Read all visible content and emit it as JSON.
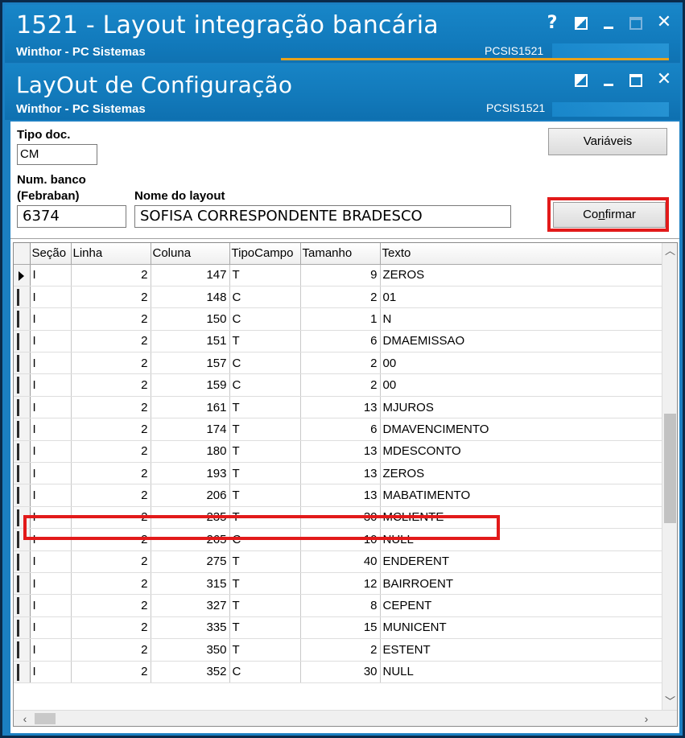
{
  "main_window": {
    "title": "1521 - Layout integração bancária",
    "subtitle": "Winthor - PC Sistemas",
    "code": "PCSIS1521"
  },
  "child_window": {
    "title": "LayOut de Configuração",
    "subtitle": "Winthor - PC Sistemas",
    "code": "PCSIS1521"
  },
  "form": {
    "tipo_doc_label": "Tipo doc.",
    "tipo_doc_value": "CM",
    "num_banco_label_line1": "Num. banco",
    "num_banco_label_line2": "(Febraban)",
    "num_banco_value": "6374",
    "nome_layout_label": "Nome do layout",
    "nome_layout_value": "SOFISA CORRESPONDENTE BRADESCO",
    "variaveis_label": "Variáveis",
    "confirmar_prefix": "Co",
    "confirmar_underlined": "n",
    "confirmar_suffix": "firmar"
  },
  "grid": {
    "columns": [
      "Seção",
      "Linha",
      "Coluna",
      "TipoCampo",
      "Tamanho",
      "Texto"
    ],
    "rows": [
      [
        "I",
        "2",
        "147",
        "T",
        "9",
        "ZEROS"
      ],
      [
        "I",
        "2",
        "148",
        "C",
        "2",
        "01"
      ],
      [
        "I",
        "2",
        "150",
        "C",
        "1",
        "N"
      ],
      [
        "I",
        "2",
        "151",
        "T",
        "6",
        "DMAEMISSAO"
      ],
      [
        "I",
        "2",
        "157",
        "C",
        "2",
        "00"
      ],
      [
        "I",
        "2",
        "159",
        "C",
        "2",
        "00"
      ],
      [
        "I",
        "2",
        "161",
        "T",
        "13",
        "MJUROS"
      ],
      [
        "I",
        "2",
        "174",
        "T",
        "6",
        "DMAVENCIMENTO"
      ],
      [
        "I",
        "2",
        "180",
        "T",
        "13",
        "MDESCONTO"
      ],
      [
        "I",
        "2",
        "193",
        "T",
        "13",
        "ZEROS"
      ],
      [
        "I",
        "2",
        "206",
        "T",
        "13",
        "MABATIMENTO"
      ],
      [
        "I",
        "2",
        "235",
        "T",
        "30",
        "MCLIENTE"
      ],
      [
        "I",
        "2",
        "265",
        "C",
        "10",
        "NULL"
      ],
      [
        "I",
        "2",
        "275",
        "T",
        "40",
        "ENDERENT"
      ],
      [
        "I",
        "2",
        "315",
        "T",
        "12",
        "BAIRROENT"
      ],
      [
        "I",
        "2",
        "327",
        "T",
        "8",
        "CEPENT"
      ],
      [
        "I",
        "2",
        "335",
        "T",
        "15",
        "MUNICENT"
      ],
      [
        "I",
        "2",
        "350",
        "T",
        "2",
        "ESTENT"
      ],
      [
        "I",
        "2",
        "352",
        "C",
        "30",
        "NULL"
      ]
    ],
    "current_row": 0,
    "highlighted_row": 6
  },
  "colors": {
    "titlebar": "#127bbd",
    "accent_line": "#e8a21c",
    "highlight": "#e21a1a"
  },
  "icons": {
    "help": "question-mark",
    "restore": "half-box",
    "minimize": "minus",
    "maximize": "square",
    "close": "x"
  }
}
